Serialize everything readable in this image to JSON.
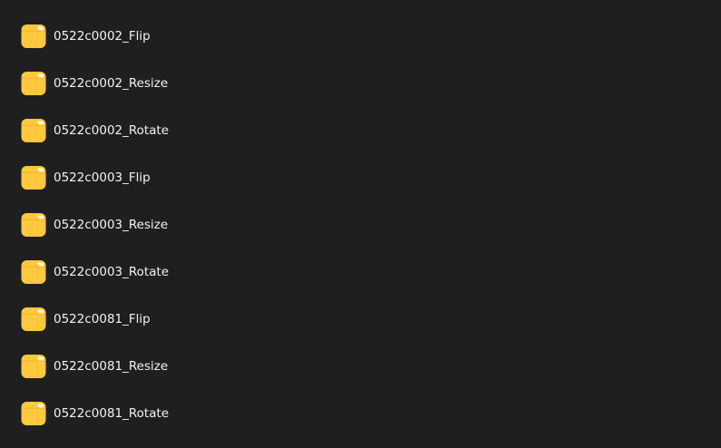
{
  "folder_list": {
    "icon": "folder-icon",
    "icon_color": "#ffc83d",
    "items": [
      {
        "name": "0522c0002_Flip"
      },
      {
        "name": "0522c0002_Resize"
      },
      {
        "name": "0522c0002_Rotate"
      },
      {
        "name": "0522c0003_Flip"
      },
      {
        "name": "0522c0003_Resize"
      },
      {
        "name": "0522c0003_Rotate"
      },
      {
        "name": "0522c0081_Flip"
      },
      {
        "name": "0522c0081_Resize"
      },
      {
        "name": "0522c0081_Rotate"
      }
    ]
  }
}
